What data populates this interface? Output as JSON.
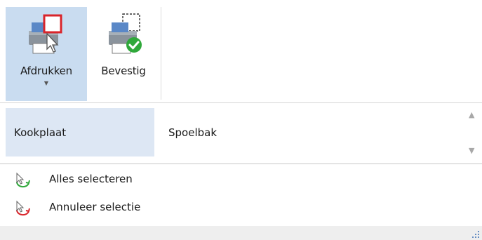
{
  "ribbon": {
    "print_label": "Afdrukken",
    "confirm_label": "Bevestig",
    "print_icon": "printer-preview-icon",
    "confirm_icon": "printer-check-icon",
    "accent_selected": "#c9dcf0"
  },
  "gallery": {
    "items": [
      {
        "label": "Kookplaat",
        "selected": true
      },
      {
        "label": "Spoelbak",
        "selected": false
      }
    ]
  },
  "actions": {
    "select_all": "Alles selecteren",
    "cancel_selection": "Annuleer selectie"
  },
  "colors": {
    "selection_bg": "#dde7f4",
    "status_bg": "#eeeeee",
    "check_green": "#2fa83a",
    "red": "#d9242a"
  }
}
